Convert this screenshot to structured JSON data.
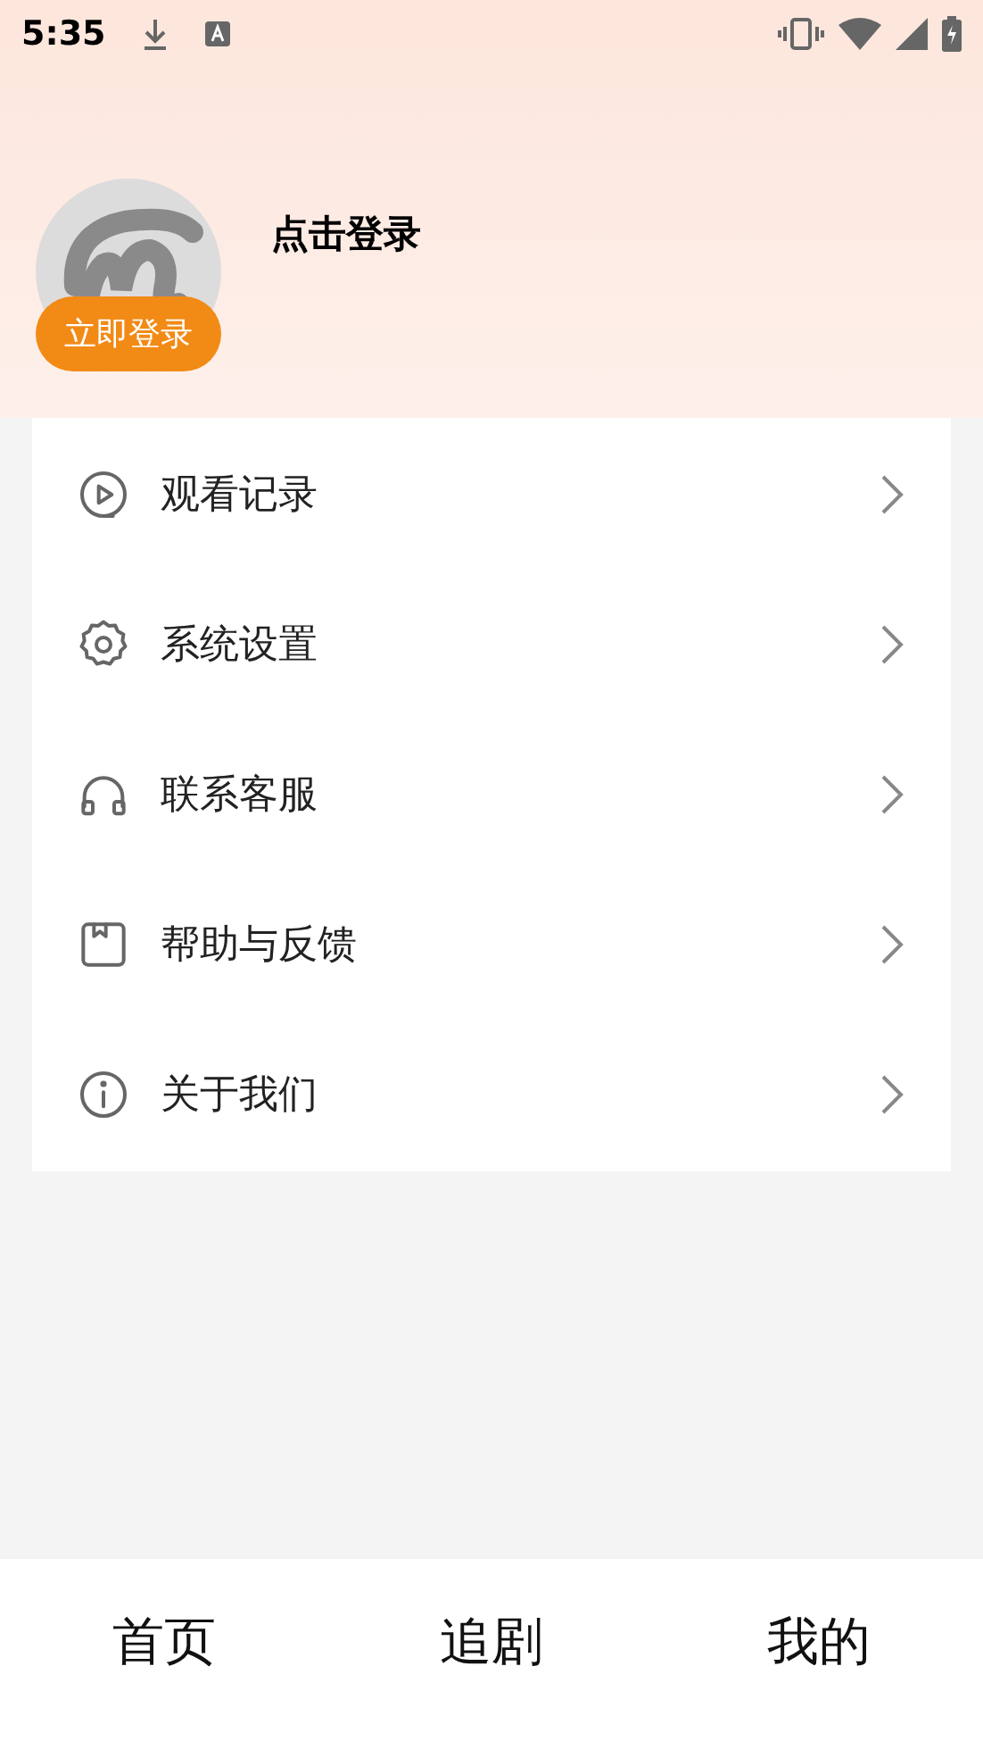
{
  "status_bar": {
    "time": "5:35"
  },
  "profile": {
    "name": "点击登录",
    "login_button": "立即登录"
  },
  "menu": [
    {
      "kind": "history",
      "label": "观看记录"
    },
    {
      "kind": "settings",
      "label": "系统设置"
    },
    {
      "kind": "support",
      "label": "联系客服"
    },
    {
      "kind": "feedback",
      "label": "帮助与反馈"
    },
    {
      "kind": "about",
      "label": "关于我们"
    }
  ],
  "bottom_nav": [
    {
      "label": "首页"
    },
    {
      "label": "追剧"
    },
    {
      "label": "我的"
    }
  ]
}
